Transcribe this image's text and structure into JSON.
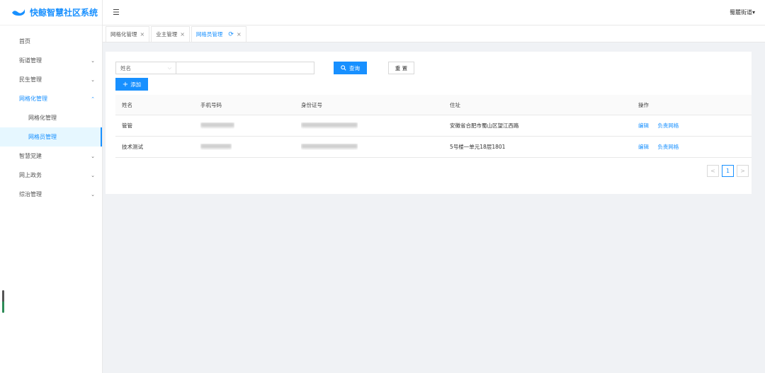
{
  "app": {
    "title": "快鲸智慧社区系统"
  },
  "header": {
    "user_menu": "蜀麓街道▾"
  },
  "sidebar": {
    "items": [
      {
        "label": "首页",
        "chev": ""
      },
      {
        "label": "街道管理",
        "chev": "⌄"
      },
      {
        "label": "民生管理",
        "chev": "⌄"
      },
      {
        "label": "网格化管理",
        "chev": "⌃"
      },
      {
        "label": "网格化管理",
        "chev": ""
      },
      {
        "label": "网格员管理",
        "chev": ""
      },
      {
        "label": "智慧党建",
        "chev": "⌄"
      },
      {
        "label": "网上政务",
        "chev": "⌄"
      },
      {
        "label": "综治管理",
        "chev": "⌄"
      }
    ]
  },
  "tabs": [
    {
      "label": "网格化管理"
    },
    {
      "label": "业主管理"
    },
    {
      "label": "网格员管理"
    }
  ],
  "search": {
    "field_select": "姓名",
    "input_value": "",
    "query_label": "查询",
    "reset_label": "重 置",
    "add_label": "添加"
  },
  "table": {
    "headers": [
      "姓名",
      "手机号码",
      "身份证号",
      "住址",
      "操作"
    ],
    "rows": [
      {
        "name": "管管",
        "address": "安徽省合肥市蜀山区望江西路",
        "actions": [
          "编辑",
          "负责网格"
        ]
      },
      {
        "name": "技术测试",
        "address": "5号楼一单元18层1801",
        "actions": [
          "编辑",
          "负责网格"
        ]
      }
    ]
  },
  "pagination": {
    "prev": "<",
    "current": "1",
    "next": ">"
  }
}
